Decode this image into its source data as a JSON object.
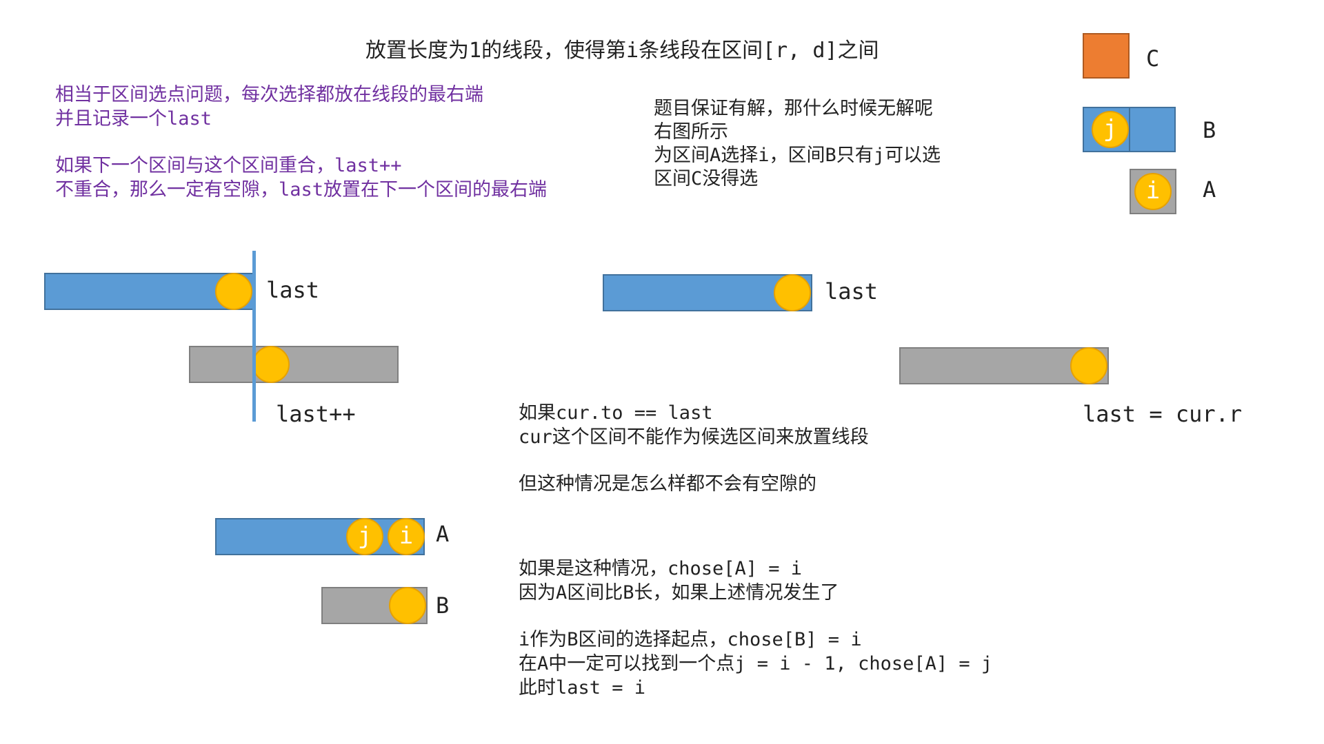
{
  "title": "放置长度为1的线段，使得第i条线段在区间[r, d]之间",
  "intro": {
    "line1": "相当于区间选点问题，每次选择都放在线段的最右端",
    "line2": "并且记录一个last",
    "line3": "如果下一个区间与这个区间重合，last++",
    "line4": "不重合，那么一定有空隙，last放置在下一个区间的最右端"
  },
  "question": {
    "line1": "题目保证有解，那什么时候无解呢",
    "line2": "右图所示",
    "line3": "为区间A选择i，区间B只有j可以选",
    "line4": "区间C没得选"
  },
  "legend": {
    "c_label": "C",
    "b_label": "B",
    "a_label": "A",
    "b_dot": "j",
    "a_dot": "i"
  },
  "case1": {
    "top_label": "last",
    "bottom_label": "last++"
  },
  "case2": {
    "top_label": "last",
    "bottom_label": "last = cur.r"
  },
  "middle": {
    "line1": "如果cur.to == last",
    "line2": "cur这个区间不能作为候选区间来放置线段",
    "line3": "但这种情况是怎么样都不会有空隙的"
  },
  "case3": {
    "a_label": "A",
    "b_label": "B",
    "dot_j": "j",
    "dot_i": "i"
  },
  "explain": {
    "line1": "如果是这种情况，chose[A] = i",
    "line2": "因为A区间比B长，如果上述情况发生了",
    "line3": "i作为B区间的选择起点，chose[B] = i",
    "line4": "在A中一定可以找到一个点j = i - 1, chose[A] = j",
    "line5": "此时last = i"
  },
  "colors": {
    "blue": "#5b9bd5",
    "gray": "#a6a6a6",
    "orange": "#ed7d31",
    "yellow": "#ffc000",
    "purple": "#7030a0"
  }
}
